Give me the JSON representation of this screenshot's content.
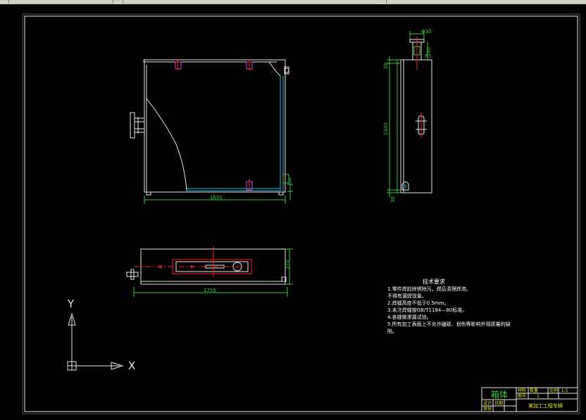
{
  "drawing": {
    "dims": {
      "front_width": "1650",
      "side_top": "20",
      "side_height": "1340",
      "side_bottom": "30",
      "side_nozzle_w": "Φ30",
      "side_nozzle_h": "60",
      "side_nozzle_r": "R5",
      "plan_width": "1755",
      "plan_depth": "370"
    },
    "tech": {
      "title": "技术要求",
      "lines": [
        "1.零件焊前除锈除污，焊后清理焊渣。",
        "不得有漏焊现象。",
        "2.焊缝高度不低于0.5mm。",
        "3.未注焊缝按GB/T1184—80标准。",
        "4.各缝做渗漏试验。",
        "5.所有加工表面上不允许磕碰、划伤等影响外观质量的缺",
        "陷。"
      ]
    },
    "titleblock": {
      "part_name": "箱体",
      "project": "某加工工程车辆",
      "cells": [
        "材料",
        "数量",
        "比例",
        "1:5",
        "图号",
        "1",
        "设计",
        "审核",
        "日期"
      ]
    },
    "axis": {
      "x_label": "X",
      "y_label": "Y"
    }
  }
}
